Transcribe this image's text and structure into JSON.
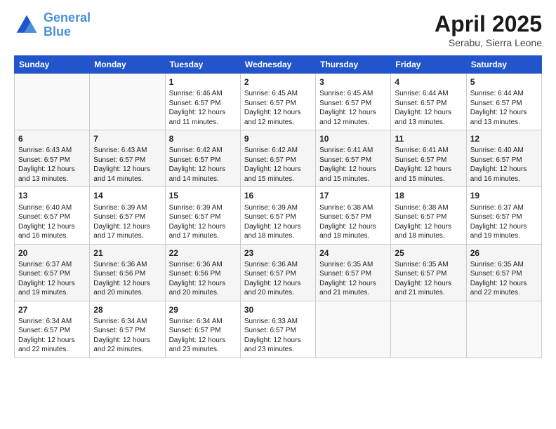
{
  "header": {
    "logo_line1": "General",
    "logo_line2": "Blue",
    "title": "April 2025",
    "subtitle": "Serabu, Sierra Leone"
  },
  "days_of_week": [
    "Sunday",
    "Monday",
    "Tuesday",
    "Wednesday",
    "Thursday",
    "Friday",
    "Saturday"
  ],
  "weeks": [
    [
      {
        "day": "",
        "sunrise": "",
        "sunset": "",
        "daylight": "",
        "empty": true
      },
      {
        "day": "",
        "sunrise": "",
        "sunset": "",
        "daylight": "",
        "empty": true
      },
      {
        "day": "1",
        "sunrise": "Sunrise: 6:46 AM",
        "sunset": "Sunset: 6:57 PM",
        "daylight": "Daylight: 12 hours and 11 minutes."
      },
      {
        "day": "2",
        "sunrise": "Sunrise: 6:45 AM",
        "sunset": "Sunset: 6:57 PM",
        "daylight": "Daylight: 12 hours and 12 minutes."
      },
      {
        "day": "3",
        "sunrise": "Sunrise: 6:45 AM",
        "sunset": "Sunset: 6:57 PM",
        "daylight": "Daylight: 12 hours and 12 minutes."
      },
      {
        "day": "4",
        "sunrise": "Sunrise: 6:44 AM",
        "sunset": "Sunset: 6:57 PM",
        "daylight": "Daylight: 12 hours and 13 minutes."
      },
      {
        "day": "5",
        "sunrise": "Sunrise: 6:44 AM",
        "sunset": "Sunset: 6:57 PM",
        "daylight": "Daylight: 12 hours and 13 minutes."
      }
    ],
    [
      {
        "day": "6",
        "sunrise": "Sunrise: 6:43 AM",
        "sunset": "Sunset: 6:57 PM",
        "daylight": "Daylight: 12 hours and 13 minutes."
      },
      {
        "day": "7",
        "sunrise": "Sunrise: 6:43 AM",
        "sunset": "Sunset: 6:57 PM",
        "daylight": "Daylight: 12 hours and 14 minutes."
      },
      {
        "day": "8",
        "sunrise": "Sunrise: 6:42 AM",
        "sunset": "Sunset: 6:57 PM",
        "daylight": "Daylight: 12 hours and 14 minutes."
      },
      {
        "day": "9",
        "sunrise": "Sunrise: 6:42 AM",
        "sunset": "Sunset: 6:57 PM",
        "daylight": "Daylight: 12 hours and 15 minutes."
      },
      {
        "day": "10",
        "sunrise": "Sunrise: 6:41 AM",
        "sunset": "Sunset: 6:57 PM",
        "daylight": "Daylight: 12 hours and 15 minutes."
      },
      {
        "day": "11",
        "sunrise": "Sunrise: 6:41 AM",
        "sunset": "Sunset: 6:57 PM",
        "daylight": "Daylight: 12 hours and 15 minutes."
      },
      {
        "day": "12",
        "sunrise": "Sunrise: 6:40 AM",
        "sunset": "Sunset: 6:57 PM",
        "daylight": "Daylight: 12 hours and 16 minutes."
      }
    ],
    [
      {
        "day": "13",
        "sunrise": "Sunrise: 6:40 AM",
        "sunset": "Sunset: 6:57 PM",
        "daylight": "Daylight: 12 hours and 16 minutes."
      },
      {
        "day": "14",
        "sunrise": "Sunrise: 6:39 AM",
        "sunset": "Sunset: 6:57 PM",
        "daylight": "Daylight: 12 hours and 17 minutes."
      },
      {
        "day": "15",
        "sunrise": "Sunrise: 6:39 AM",
        "sunset": "Sunset: 6:57 PM",
        "daylight": "Daylight: 12 hours and 17 minutes."
      },
      {
        "day": "16",
        "sunrise": "Sunrise: 6:39 AM",
        "sunset": "Sunset: 6:57 PM",
        "daylight": "Daylight: 12 hours and 18 minutes."
      },
      {
        "day": "17",
        "sunrise": "Sunrise: 6:38 AM",
        "sunset": "Sunset: 6:57 PM",
        "daylight": "Daylight: 12 hours and 18 minutes."
      },
      {
        "day": "18",
        "sunrise": "Sunrise: 6:38 AM",
        "sunset": "Sunset: 6:57 PM",
        "daylight": "Daylight: 12 hours and 18 minutes."
      },
      {
        "day": "19",
        "sunrise": "Sunrise: 6:37 AM",
        "sunset": "Sunset: 6:57 PM",
        "daylight": "Daylight: 12 hours and 19 minutes."
      }
    ],
    [
      {
        "day": "20",
        "sunrise": "Sunrise: 6:37 AM",
        "sunset": "Sunset: 6:57 PM",
        "daylight": "Daylight: 12 hours and 19 minutes."
      },
      {
        "day": "21",
        "sunrise": "Sunrise: 6:36 AM",
        "sunset": "Sunset: 6:56 PM",
        "daylight": "Daylight: 12 hours and 20 minutes."
      },
      {
        "day": "22",
        "sunrise": "Sunrise: 6:36 AM",
        "sunset": "Sunset: 6:56 PM",
        "daylight": "Daylight: 12 hours and 20 minutes."
      },
      {
        "day": "23",
        "sunrise": "Sunrise: 6:36 AM",
        "sunset": "Sunset: 6:57 PM",
        "daylight": "Daylight: 12 hours and 20 minutes."
      },
      {
        "day": "24",
        "sunrise": "Sunrise: 6:35 AM",
        "sunset": "Sunset: 6:57 PM",
        "daylight": "Daylight: 12 hours and 21 minutes."
      },
      {
        "day": "25",
        "sunrise": "Sunrise: 6:35 AM",
        "sunset": "Sunset: 6:57 PM",
        "daylight": "Daylight: 12 hours and 21 minutes."
      },
      {
        "day": "26",
        "sunrise": "Sunrise: 6:35 AM",
        "sunset": "Sunset: 6:57 PM",
        "daylight": "Daylight: 12 hours and 22 minutes."
      }
    ],
    [
      {
        "day": "27",
        "sunrise": "Sunrise: 6:34 AM",
        "sunset": "Sunset: 6:57 PM",
        "daylight": "Daylight: 12 hours and 22 minutes."
      },
      {
        "day": "28",
        "sunrise": "Sunrise: 6:34 AM",
        "sunset": "Sunset: 6:57 PM",
        "daylight": "Daylight: 12 hours and 22 minutes."
      },
      {
        "day": "29",
        "sunrise": "Sunrise: 6:34 AM",
        "sunset": "Sunset: 6:57 PM",
        "daylight": "Daylight: 12 hours and 23 minutes."
      },
      {
        "day": "30",
        "sunrise": "Sunrise: 6:33 AM",
        "sunset": "Sunset: 6:57 PM",
        "daylight": "Daylight: 12 hours and 23 minutes."
      },
      {
        "day": "",
        "sunrise": "",
        "sunset": "",
        "daylight": "",
        "empty": true
      },
      {
        "day": "",
        "sunrise": "",
        "sunset": "",
        "daylight": "",
        "empty": true
      },
      {
        "day": "",
        "sunrise": "",
        "sunset": "",
        "daylight": "",
        "empty": true
      }
    ]
  ]
}
